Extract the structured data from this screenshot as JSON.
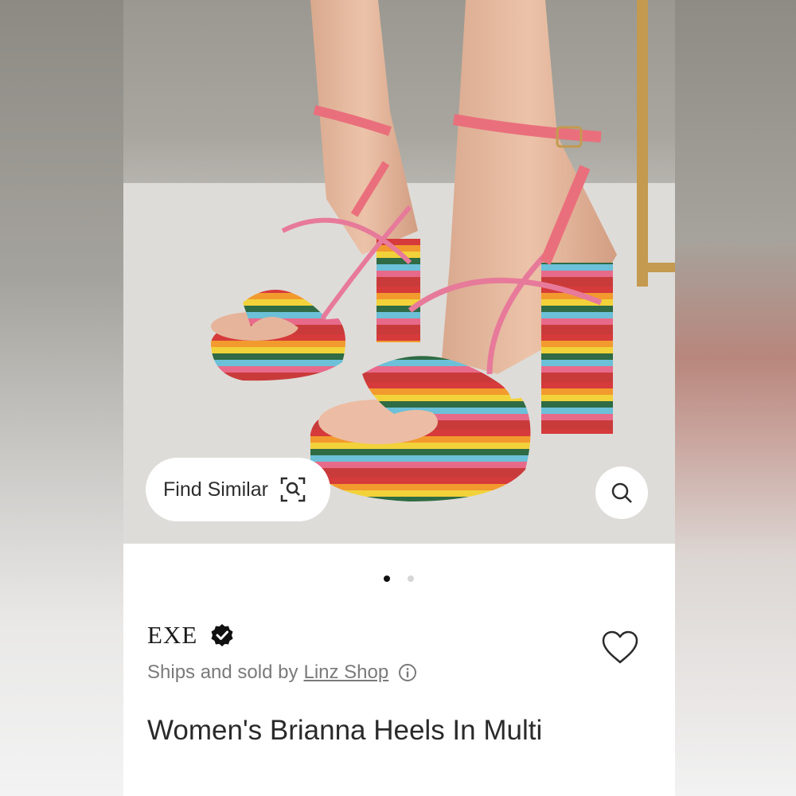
{
  "product_image": {
    "alt": "",
    "carousel": {
      "current": 1,
      "total": 2
    }
  },
  "find_similar": {
    "label": "Find Similar",
    "icon": "scan-search-icon"
  },
  "image_search": {
    "icon": "search-icon"
  },
  "brand": {
    "name": "EXE",
    "badge_icon": "verified-badge-icon"
  },
  "seller": {
    "prefix": "Ships and sold by",
    "shop_name": "Linz Shop",
    "info_icon": "info-icon"
  },
  "wishlist": {
    "icon": "heart-icon"
  },
  "product": {
    "title": "Women's Brianna Heels In Multi"
  },
  "colors": {
    "active_dot": "#111111",
    "inactive_dot": "#d6d6d6",
    "text_primary": "#2a2a2a",
    "text_secondary": "#7a7a7a"
  }
}
